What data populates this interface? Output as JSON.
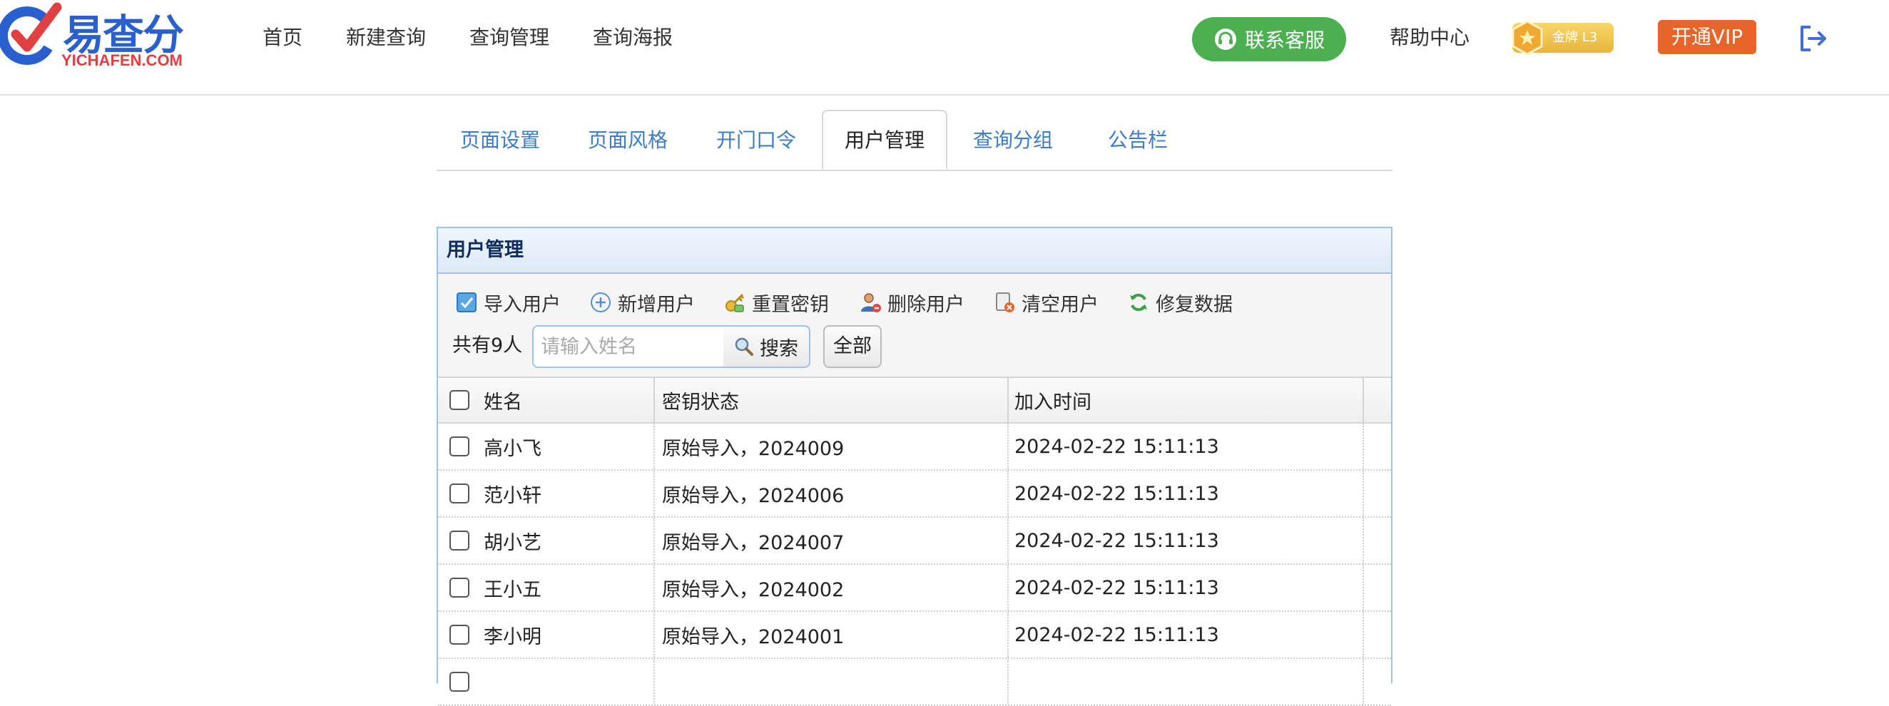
{
  "header": {
    "logo": {
      "brand": "易查分",
      "sub": "YICHAFEN.COM"
    },
    "nav": [
      {
        "id": "home",
        "label": "首页"
      },
      {
        "id": "new-query",
        "label": "新建查询"
      },
      {
        "id": "query-manage",
        "label": "查询管理"
      },
      {
        "id": "query-poster",
        "label": "查询海报"
      }
    ],
    "service_label": "联系客服",
    "help_label": "帮助中心",
    "badge_label": "金牌 L3",
    "vip_label": "开通VIP",
    "colors": {
      "brand_blue": "#2a5fcf",
      "service_green": "#4cb050",
      "vip_orange": "#e8652a",
      "link_blue": "#3c7cc9"
    }
  },
  "tabs": [
    {
      "id": "page-settings",
      "label": "页面设置",
      "active": false
    },
    {
      "id": "page-style",
      "label": "页面风格",
      "active": false
    },
    {
      "id": "door-code",
      "label": "开门口令",
      "active": false
    },
    {
      "id": "user-manage",
      "label": "用户管理",
      "active": true
    },
    {
      "id": "query-group",
      "label": "查询分组",
      "active": false
    },
    {
      "id": "bulletin",
      "label": "公告栏",
      "active": false
    }
  ],
  "panel": {
    "title": "用户管理",
    "toolbar": [
      {
        "id": "import",
        "label": "导入用户",
        "icon": "import-icon"
      },
      {
        "id": "add",
        "label": "新增用户",
        "icon": "plus-circle-icon"
      },
      {
        "id": "reset-key",
        "label": "重置密钥",
        "icon": "key-icon"
      },
      {
        "id": "delete",
        "label": "删除用户",
        "icon": "user-delete-icon"
      },
      {
        "id": "clear",
        "label": "清空用户",
        "icon": "clear-icon"
      },
      {
        "id": "repair",
        "label": "修复数据",
        "icon": "refresh-icon"
      }
    ],
    "count_label": "共有9人",
    "search": {
      "placeholder": "请输入姓名",
      "value": "",
      "button_label": "搜索"
    },
    "all_label": "全部",
    "columns": {
      "name": "姓名",
      "key_status": "密钥状态",
      "join_time": "加入时间"
    },
    "rows": [
      {
        "name": "高小飞",
        "key_status": "原始导入，2024009",
        "join_time": "2024-02-22 15:11:13"
      },
      {
        "name": "范小轩",
        "key_status": "原始导入，2024006",
        "join_time": "2024-02-22 15:11:13"
      },
      {
        "name": "胡小艺",
        "key_status": "原始导入，2024007",
        "join_time": "2024-02-22 15:11:13"
      },
      {
        "name": "王小五",
        "key_status": "原始导入，2024002",
        "join_time": "2024-02-22 15:11:13"
      },
      {
        "name": "李小明",
        "key_status": "原始导入，2024001",
        "join_time": "2024-02-22 15:11:13"
      }
    ]
  }
}
